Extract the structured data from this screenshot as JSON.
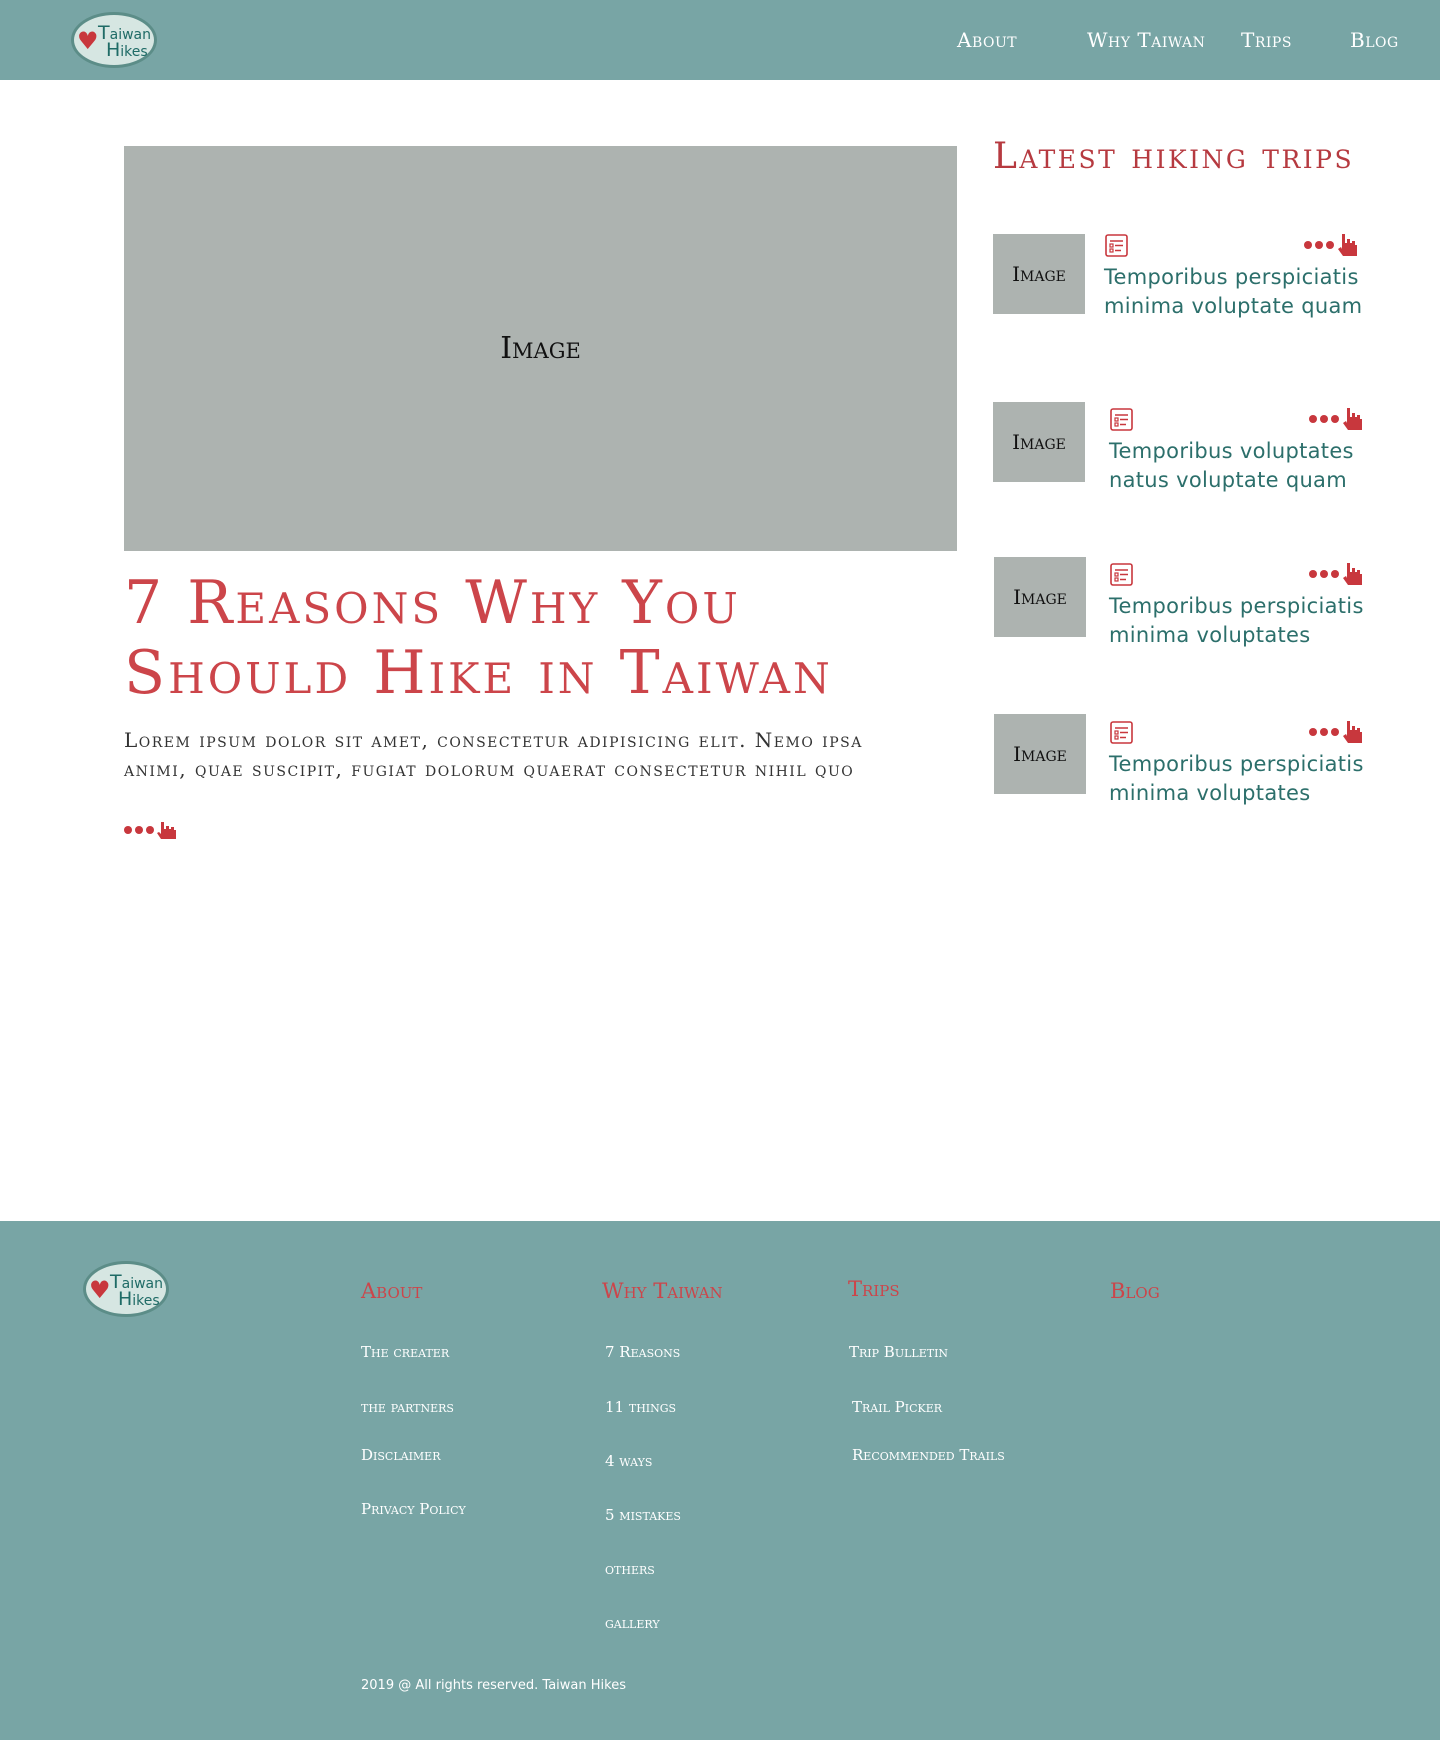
{
  "brand": {
    "logo_line1": "Taiwan",
    "logo_line2": "Hikes",
    "heart_icon": "heart-icon"
  },
  "header": {
    "nav": [
      "About",
      "Why Taiwan",
      "Trips",
      "Blog"
    ]
  },
  "article": {
    "image_label": "Image",
    "title": "7 Reasons Why You Should Hike in Taiwan",
    "excerpt": "Lorem ipsum dolor sit amet, consectetur adipisicing elit. Nemo ipsa animi, quae suscipit, fugiat dolorum quaerat consectetur nihil quo",
    "more_icon": "more-dots-pointer-icon"
  },
  "sidebar": {
    "title": "Latest hiking trips",
    "items": [
      {
        "image_label": "Image",
        "title": "Temporibus perspiciatis minima voluptate quam"
      },
      {
        "image_label": "Image",
        "title": "Temporibus voluptates natus voluptate quam"
      },
      {
        "image_label": "Image",
        "title": "Temporibus perspiciatis minima voluptates"
      },
      {
        "image_label": "Image",
        "title": "Temporibus perspiciatis minima voluptates"
      }
    ]
  },
  "footer": {
    "columns": [
      {
        "heading": "About",
        "links": [
          "The creater",
          "the partners",
          "Disclaimer",
          "Privacy Policy"
        ]
      },
      {
        "heading": "Why Taiwan",
        "links": [
          "7 Reasons",
          "11 things",
          "4 ways",
          "5 mistakes",
          "others",
          "gallery"
        ]
      },
      {
        "heading": "Trips",
        "links": [
          "Trip Bulletin",
          "Trail Picker",
          "Recommended Trails"
        ]
      },
      {
        "heading": "Blog",
        "links": []
      }
    ],
    "copyright": "2019 @ All rights reserved. Taiwan Hikes"
  },
  "colors": {
    "teal": "#78a5a5",
    "accent_red": "#cc454a",
    "image_gray": "#adb3b0",
    "trip_text": "#2c6f6b"
  }
}
